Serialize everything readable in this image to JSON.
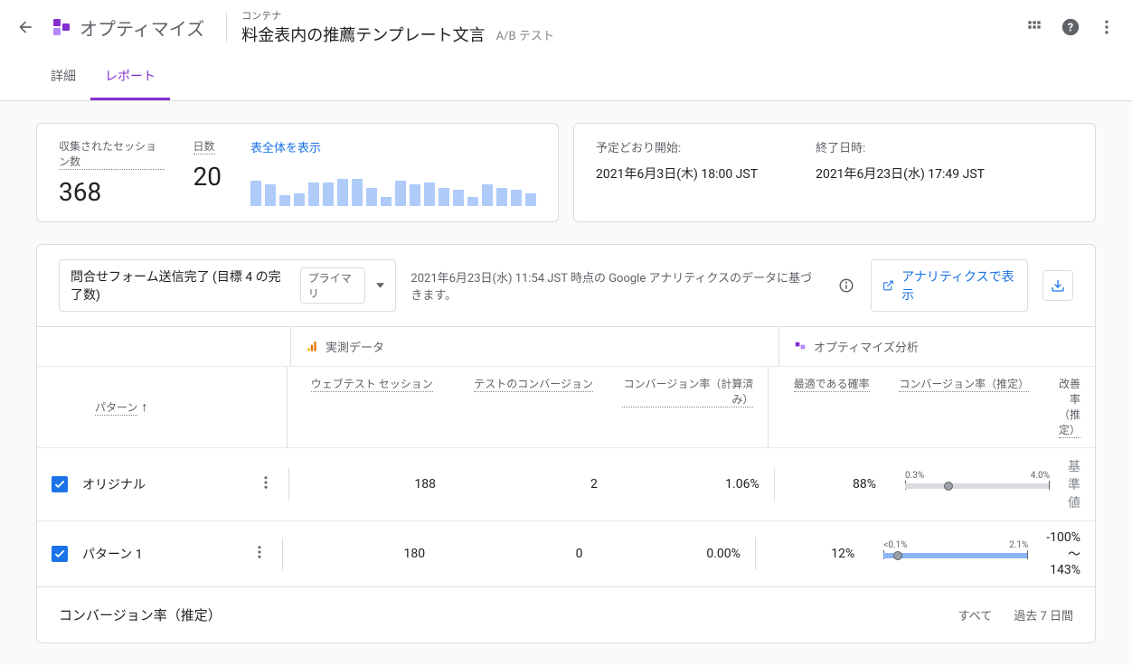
{
  "header": {
    "product_name": "オプティマイズ",
    "container_label": "コンテナ",
    "experiment_title": "料金表内の推薦テンプレート文言",
    "test_type": "A/B テスト"
  },
  "tabs": {
    "details": "詳細",
    "report": "レポート"
  },
  "summary": {
    "sessions_label": "収集されたセッション数",
    "sessions_value": "368",
    "days_label": "日数",
    "days_value": "20",
    "show_full_table": "表全体を表示",
    "sparkbars": [
      28,
      24,
      12,
      14,
      26,
      26,
      30,
      30,
      20,
      10,
      28,
      24,
      26,
      20,
      18,
      10,
      24,
      20,
      18,
      14
    ]
  },
  "dates": {
    "start_label": "予定どおり開始:",
    "start_value": "2021年6月3日(木) 18:00 JST",
    "end_label": "終了日時:",
    "end_value": "2021年6月23日(水) 17:49 JST"
  },
  "objective": {
    "name": "問合せフォーム送信完了 (目標 4 の完了数)",
    "badge": "プライマリ",
    "info_text": "2021年6月23日(水) 11:54 JST 時点の Google アナリティクスのデータに基づきます。",
    "analytics_link": "アナリティクスで表示"
  },
  "sections": {
    "actual": "実測データ",
    "optimize": "オプティマイズ分析"
  },
  "columns": {
    "variant": "パターン",
    "sessions": "ウェブテスト セッション",
    "conversions": "テストのコンバージョン",
    "rate": "コンバージョン率（計算済み）",
    "best": "最適である確率",
    "conv_est": "コンバージョン率（推定）",
    "improvement": "改善率（推定）"
  },
  "rows": [
    {
      "name": "オリジナル",
      "sessions": "188",
      "conversions": "2",
      "rate": "1.06%",
      "best": "88%",
      "ci_low": "0.3%",
      "ci_high": "4.0%",
      "improvement": "基準値",
      "blue": false
    },
    {
      "name": "パターン 1",
      "sessions": "180",
      "conversions": "0",
      "rate": "0.00%",
      "best": "12%",
      "ci_low": "<0.1%",
      "ci_high": "2.1%",
      "improvement": "-100%～143%",
      "blue": true
    }
  ],
  "chart": {
    "title": "コンバージョン率（推定）",
    "filter_all": "すべて",
    "filter_7d": "過去 7 日間"
  }
}
